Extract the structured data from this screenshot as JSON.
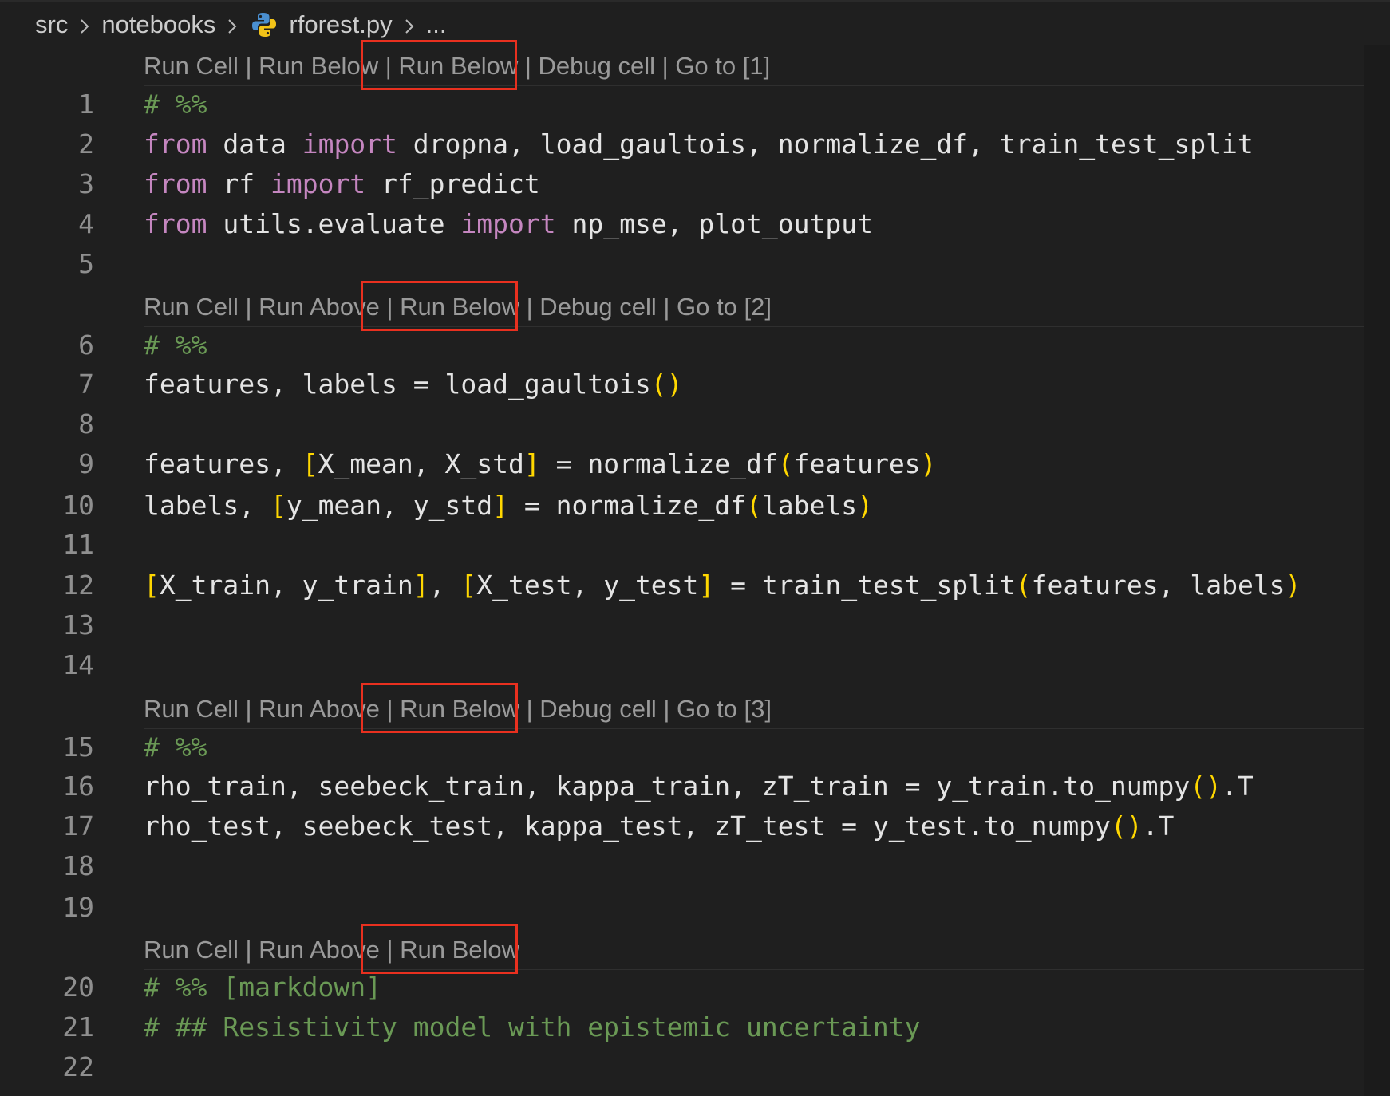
{
  "breadcrumb": {
    "items": [
      "src",
      "notebooks",
      "rforest.py",
      "..."
    ]
  },
  "colors": {
    "background": "#1f1f1f",
    "keyword": "#c586c0",
    "comment": "#6a9955",
    "bracket": "#ffd700",
    "highlight_box": "#e8301f",
    "codelens": "#9a9a9a"
  },
  "codelens": [
    "Run Cell | Run Below | Run Below | Debug cell | Go to [1]",
    "Run Cell | Run Above | Run Below | Debug cell | Go to [2]",
    "Run Cell | Run Above | Run Below | Debug cell | Go to [3]",
    "Run Cell | Run Above | Run Below"
  ],
  "lines": [
    {
      "n": "1",
      "t": "# %%"
    },
    {
      "n": "2",
      "t": "from data import dropna, load_gaultois, normalize_df, train_test_split"
    },
    {
      "n": "3",
      "t": "from rf import rf_predict"
    },
    {
      "n": "4",
      "t": "from utils.evaluate import np_mse, plot_output"
    },
    {
      "n": "5",
      "t": ""
    },
    {
      "n": "6",
      "t": "# %%"
    },
    {
      "n": "7",
      "t": "features, labels = load_gaultois()"
    },
    {
      "n": "8",
      "t": ""
    },
    {
      "n": "9",
      "t": "features, [X_mean, X_std] = normalize_df(features)"
    },
    {
      "n": "10",
      "t": "labels, [y_mean, y_std] = normalize_df(labels)"
    },
    {
      "n": "11",
      "t": ""
    },
    {
      "n": "12",
      "t": "[X_train, y_train], [X_test, y_test] = train_test_split(features, labels)"
    },
    {
      "n": "13",
      "t": ""
    },
    {
      "n": "14",
      "t": ""
    },
    {
      "n": "15",
      "t": "# %%"
    },
    {
      "n": "16",
      "t": "rho_train, seebeck_train, kappa_train, zT_train = y_train.to_numpy().T"
    },
    {
      "n": "17",
      "t": "rho_test, seebeck_test, kappa_test, zT_test = y_test.to_numpy().T"
    },
    {
      "n": "18",
      "t": ""
    },
    {
      "n": "19",
      "t": ""
    },
    {
      "n": "20",
      "t": "# %% [markdown]"
    },
    {
      "n": "21",
      "t": "# ## Resistivity model with epistemic uncertainty"
    },
    {
      "n": "22",
      "t": ""
    }
  ]
}
